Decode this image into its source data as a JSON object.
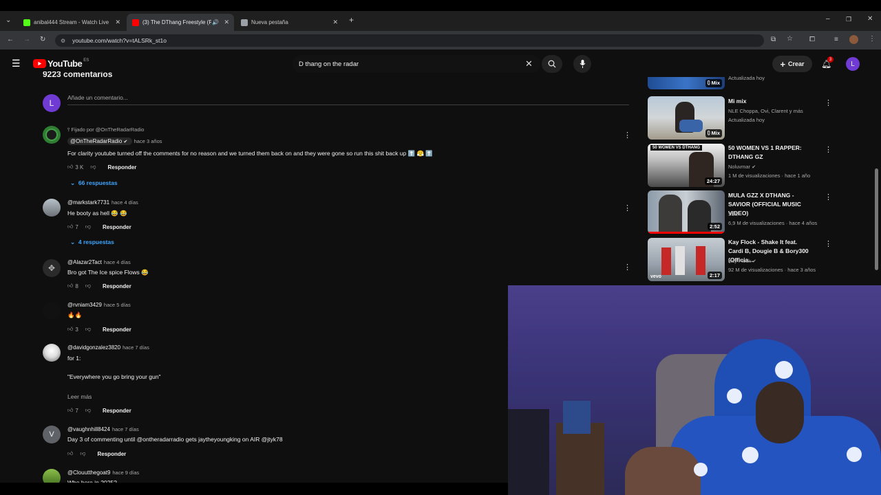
{
  "browser": {
    "tabs": [
      {
        "title": "anibal444 Stream - Watch Live",
        "favicon_color": "#53fc18",
        "active": false
      },
      {
        "title": "(3) The DThang Freestyle (P...",
        "favicon_color": "#ff0000",
        "active": true
      },
      {
        "title": "Nueva pestaña",
        "favicon_color": "#9aa0a6",
        "active": false
      }
    ],
    "url": "youtube.com/watch?v=tALSRk_st1o"
  },
  "youtube": {
    "logo_text": "YouTube",
    "logo_region": "ES",
    "search_value": "D thang on the radar",
    "create_label": "Crear",
    "notification_count": "3",
    "avatar_letter": "L"
  },
  "comments_section": {
    "header": "9223 comentarios",
    "add_comment_placeholder": "Añade un comentario...",
    "user_letter": "L",
    "pinned_label": "Fijado por @OnTheRadarRadio",
    "comments": [
      {
        "author": "@OnTheRadarRadio",
        "verified": true,
        "time": "hace 3 años",
        "text": "For clarity youtube turned off the comments for no reason and we turned them back on and they were gone so run this shit back up ⬆️ 😤 ⬆️",
        "likes": "3 K",
        "reply_label": "Responder",
        "replies": "66 respuestas",
        "avatar_color": "#2e7d32"
      },
      {
        "author": "@markstark7731",
        "time": "hace 4 días",
        "text": "He booty as hell 😂 😂",
        "likes": "7",
        "reply_label": "Responder",
        "replies": "4 respuestas",
        "avatar_color": "#7a7f84"
      },
      {
        "author": "@Alazar2Tact",
        "time": "hace 4 días",
        "text": "Bro got The Ice spice Flows 😂",
        "likes": "8",
        "reply_label": "Responder",
        "avatar_color": "#4a4a4a"
      },
      {
        "author": "@rvniam3429",
        "time": "hace 5 días",
        "text": "🔥🔥",
        "likes": "3",
        "reply_label": "Responder",
        "avatar_color": "#111111"
      },
      {
        "author": "@davidgonzalez3820",
        "time": "hace 7 días",
        "text": "for 1:",
        "text2": "\"Everywhere you go bring your gun\"",
        "read_more": "Leer más",
        "likes": "7",
        "reply_label": "Responder",
        "avatar_color": "#e8e8e8"
      },
      {
        "author": "@vaughnhill8424",
        "time": "hace 7 días",
        "text": "Day 3 of commenting until @ontheradarradio gets jaytheyoungking on AIR @jtyk78",
        "likes": "",
        "reply_label": "Responder",
        "avatar_letter": "V",
        "avatar_color": "#5f6368"
      },
      {
        "author": "@Clouutthegoat9",
        "time": "hace 9 días",
        "text": "Who here in 2025?",
        "avatar_color": "#6a8f3a"
      }
    ]
  },
  "sidebar": {
    "videos": [
      {
        "title": "",
        "meta1": "Actualizada hoy",
        "badge": "Mix",
        "thumb_color": "#2b5aa8"
      },
      {
        "title": "Mi mix",
        "meta1": "NLE Choppa, Ovi, Clarent y más",
        "meta2": "Actualizada hoy",
        "badge": "Mix",
        "thumb_color": "#9eb0c4"
      },
      {
        "title": "50 WOMEN VS 1 RAPPER: DTHANG GZ",
        "meta1": "Noluvmar",
        "meta2": "1 M de visualizaciones · hace 1 año",
        "duration": "24:27",
        "thumb_text": "50 WOMEN VS DTHANG",
        "thumb_color": "#d9d9d9"
      },
      {
        "title": "MULA GZZ X DTHANG - SAVIOR (OFFICIAL MUSIC VIDEO)",
        "meta1": "3GE",
        "meta2": "6,9 M de visualizaciones · hace 4 años",
        "duration": "2:52",
        "thumb_color": "#7d8896"
      },
      {
        "title": "Kay Flock - Shake It feat. Cardi B, Dougie B & Bory300 (Officia...",
        "meta1": "Kay Flock",
        "meta2": "92 M de visualizaciones · hace 3 años",
        "duration": "2:17",
        "thumb_label": "vevo",
        "thumb_color": "#9aa3ad"
      }
    ]
  }
}
